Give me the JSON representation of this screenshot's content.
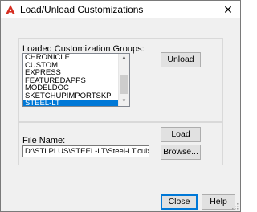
{
  "window": {
    "title": "Load/Unload Customizations",
    "close_glyph": "✕",
    "app_icon": "autocad-a-icon",
    "accent_color": "#d62d20"
  },
  "groups_section": {
    "label": "Loaded Customization Groups:",
    "items": [
      "CHRONICLE",
      "CUSTOM",
      "EXPRESS",
      "FEATUREDAPPS",
      "MODELDOC",
      "SKETCHUPIMPORTSKP",
      "STEEL-LT"
    ],
    "selected": "STEEL-LT",
    "selection_color": "#0078d7"
  },
  "buttons": {
    "unload": "Unload",
    "load": "Load",
    "browse": "Browse...",
    "close": "Close",
    "help": "Help"
  },
  "file_section": {
    "label": "File Name:",
    "value": "D:\\STLPLUS\\STEEL-LT\\Steel-LT.cuix"
  }
}
